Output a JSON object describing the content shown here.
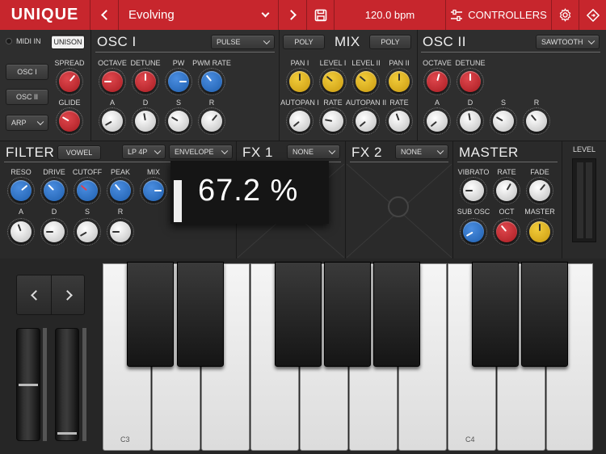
{
  "topbar": {
    "logo": "UNIQUE",
    "preset_name": "Evolving",
    "tempo": "120.0 bpm",
    "controllers_label": "CONTROLLERS"
  },
  "left": {
    "midi_in": "MIDI IN",
    "unison": "UNISON",
    "osc1": "OSC I",
    "osc2": "OSC II",
    "arp": "ARP",
    "spread": "SPREAD",
    "glide": "GLIDE"
  },
  "osc1": {
    "title": "OSC I",
    "waveform": "PULSE",
    "labels": [
      "OCTAVE",
      "DETUNE",
      "PW",
      "PWM RATE"
    ],
    "env_labels": [
      "A",
      "D",
      "S",
      "R"
    ]
  },
  "mix": {
    "title": "MIX",
    "poly1": "POLY",
    "poly2": "POLY",
    "labels": [
      "PAN I",
      "LEVEL I",
      "LEVEL II",
      "PAN II"
    ],
    "labels2": [
      "AUTOPAN I",
      "RATE",
      "AUTOPAN II",
      "RATE"
    ]
  },
  "osc2": {
    "title": "OSC II",
    "waveform": "SAWTOOTH",
    "labels": [
      "OCTAVE",
      "DETUNE"
    ],
    "env_labels": [
      "A",
      "D",
      "S",
      "R"
    ]
  },
  "filter": {
    "title": "FILTER",
    "vowel": "VOWEL",
    "type": "LP 4P",
    "mod": "ENVELOPE",
    "labels": [
      "RESO",
      "DRIVE",
      "CUTOFF",
      "PEAK",
      "MIX"
    ],
    "env_labels": [
      "A",
      "D",
      "S",
      "R"
    ]
  },
  "value_popup": "67.2 %",
  "fx1": {
    "title": "FX 1",
    "value": "NONE"
  },
  "fx2": {
    "title": "FX 2",
    "value": "NONE"
  },
  "master": {
    "title": "MASTER",
    "labels": [
      "VIBRATO",
      "RATE",
      "FADE"
    ],
    "labels2": [
      "SUB OSC",
      "OCT",
      "MASTER"
    ]
  },
  "level": {
    "title": "LEVEL"
  },
  "keyboard": {
    "c3": "C3",
    "c4": "C4"
  }
}
